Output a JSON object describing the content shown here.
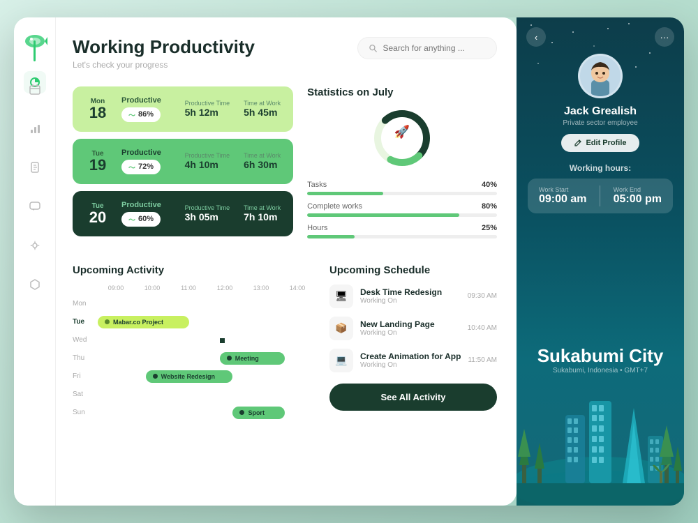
{
  "header": {
    "title": "Working Productivity",
    "subtitle": "Let's check your progress",
    "search_placeholder": "Search for anything ..."
  },
  "sidebar": {
    "logo_alt": "fish-logo",
    "items": [
      {
        "id": "chart-pie",
        "icon": "◑",
        "active": true
      },
      {
        "id": "calendar",
        "icon": "▦"
      },
      {
        "id": "bar-chart",
        "icon": "▐"
      },
      {
        "id": "document",
        "icon": "▤"
      },
      {
        "id": "chat",
        "icon": "▣"
      },
      {
        "id": "settings",
        "icon": "◎"
      },
      {
        "id": "hexagon",
        "icon": "⬡"
      }
    ]
  },
  "productivity_cards": [
    {
      "day_label": "Mon",
      "day_num": "18",
      "theme": "green-light",
      "label": "Productive",
      "pct": "86%",
      "productive_time_label": "Productive Time",
      "productive_time": "5h 12m",
      "time_at_work_label": "Time at Work",
      "time_at_work": "5h 45m"
    },
    {
      "day_label": "Tue",
      "day_num": "19",
      "theme": "green-mid",
      "label": "Productive",
      "pct": "72%",
      "productive_time_label": "Productive Time",
      "productive_time": "4h 10m",
      "time_at_work_label": "Time at Work",
      "time_at_work": "6h 30m"
    },
    {
      "day_label": "Tue",
      "day_num": "20",
      "theme": "green-dark",
      "label": "Productive",
      "pct": "60%",
      "productive_time_label": "Productive Time",
      "productive_time": "3h 05m",
      "time_at_work_label": "Time at Work",
      "time_at_work": "7h 10m"
    }
  ],
  "statistics": {
    "title": "Statistics on July",
    "bars": [
      {
        "label": "Tasks",
        "pct": 40,
        "color": "#5fc878"
      },
      {
        "label": "Complete works",
        "pct": 80,
        "color": "#5fc878"
      },
      {
        "label": "Hours",
        "pct": 25,
        "color": "#5fc878"
      }
    ]
  },
  "upcoming_activity": {
    "title": "Upcoming Activity",
    "time_labels": [
      "09:00",
      "10:00",
      "11:00",
      "12:00",
      "13:00",
      "14:00"
    ],
    "days": [
      "Mon",
      "Tue",
      "Wed",
      "Thu",
      "Fri",
      "Sat",
      "Sun"
    ],
    "active_day": "Tue",
    "bars": [
      {
        "day": "Tue",
        "label": "Mabar.co Project",
        "color": "#c8f060",
        "left_pct": 5,
        "width_pct": 28
      },
      {
        "day": "Thu",
        "label": "Meeting",
        "color": "#5fc878",
        "left_pct": 42,
        "width_pct": 22
      },
      {
        "day": "Fri",
        "label": "Website Redesign",
        "color": "#5fc878",
        "left_pct": 22,
        "width_pct": 32
      },
      {
        "day": "Sun",
        "label": "Sport",
        "color": "#5fc878",
        "left_pct": 50,
        "width_pct": 18
      }
    ]
  },
  "upcoming_schedule": {
    "title": "Upcoming Schedule",
    "items": [
      {
        "icon": "🖥",
        "name": "Desk Time Redesign",
        "sub": "Working On",
        "time": "09:30 AM"
      },
      {
        "icon": "📦",
        "name": "New Landing Page",
        "sub": "Working On",
        "time": "10:40 AM"
      },
      {
        "icon": "💻",
        "name": "Create Animation for App",
        "sub": "Working On",
        "time": "11:50 AM"
      }
    ],
    "see_all_label": "See All Activity"
  },
  "right_panel": {
    "profile": {
      "name": "Jack Grealish",
      "role": "Private sector employee",
      "edit_label": "Edit Profile"
    },
    "working_hours": {
      "title": "Working hours:",
      "work_start_label": "Work Start",
      "work_start": "09:00 am",
      "work_end_label": "Work End",
      "work_end": "05:00 pm"
    },
    "city": {
      "name": "Sukabumi City",
      "sub": "Sukabumi, Indonesia  •  GMT+7"
    }
  }
}
